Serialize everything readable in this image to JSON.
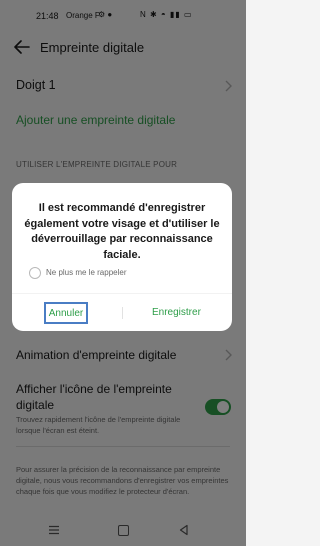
{
  "status_bar": {
    "time": "21:48",
    "carrier": "Orange F",
    "left_icons": "⚙ ●",
    "right_icons": "N ✱ ◓ ▮▮ ▭"
  },
  "header": {
    "title": "Empreinte digitale"
  },
  "fingerprints": [
    {
      "label": "Doigt 1"
    }
  ],
  "add_fingerprint": "Ajouter une empreinte digitale",
  "section_label": "UTILISER L'EMPREINTE DIGITALE POUR",
  "animation_label": "Animation d'empreinte digitale",
  "show_icon": {
    "label": "Afficher l'icône de l'empreinte digitale",
    "description": "Trouvez rapidement l'icône de l'empreinte digitale lorsque l'écran est éteint.",
    "enabled": true
  },
  "footer_note": "Pour assurer la précision de la reconnaissance par empreinte digitale, nous vous recommandons d'enregistrer vos empreintes chaque fois que vous modifiez le protecteur d'écran.",
  "dialog": {
    "message": "Il est recommandé d'enregistrer également votre visage et d'utiliser le déverrouillage par reconnaissance faciale.",
    "checkbox_label": "Ne plus me le rappeler",
    "cancel_label": "Annuler",
    "save_label": "Enregistrer"
  },
  "colors": {
    "accent": "#2e9e49",
    "focus_outline": "#4a7dc4"
  }
}
